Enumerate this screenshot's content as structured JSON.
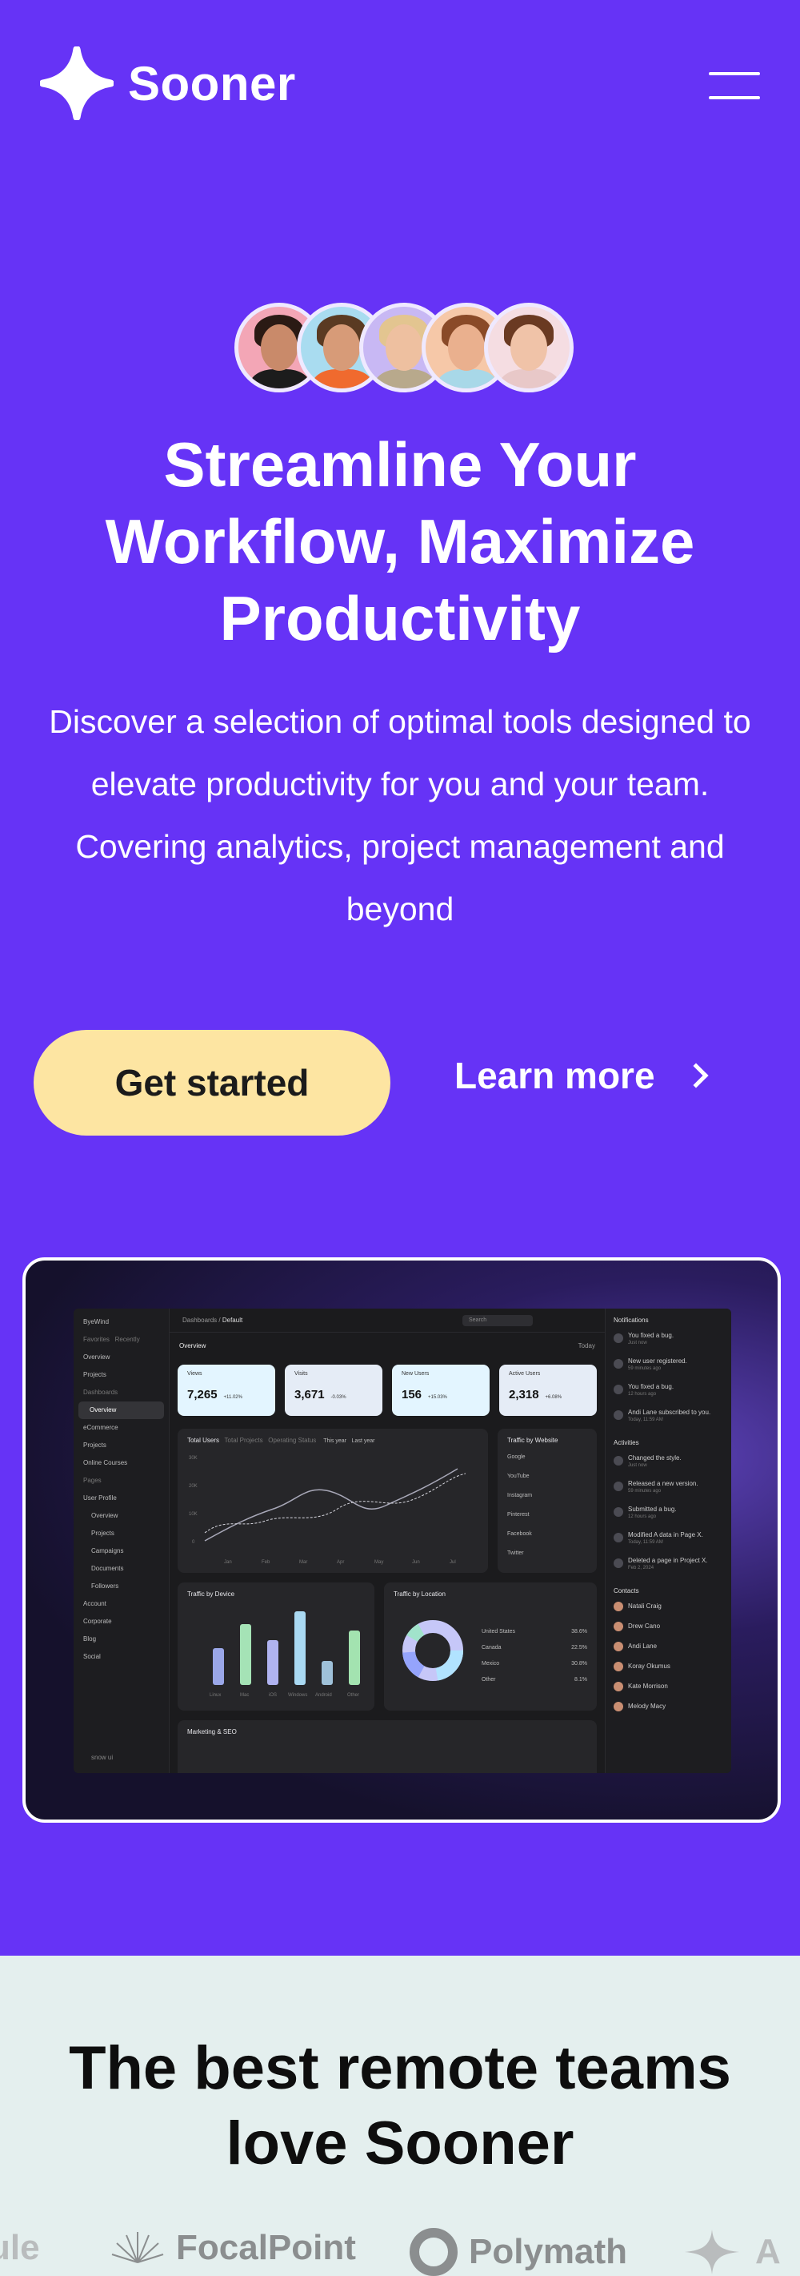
{
  "brand": {
    "name": "Sooner"
  },
  "hero": {
    "headline": "Streamline Your Workflow, Maximize Productivity",
    "subtitle": "Discover a selection of optimal tools designed to elevate productivity for you and your team. Covering analytics, project management and beyond",
    "primary_cta": "Get started",
    "secondary_cta": "Learn more"
  },
  "colors": {
    "hero_bg": "#6633f6",
    "cta_bg": "#fde5a2",
    "section_bg": "#e4efee"
  },
  "dashboard": {
    "user": "ByeWind",
    "sidebar_tabs": [
      "Favorites",
      "Recently"
    ],
    "sidebar_favorites": [
      "Overview",
      "Projects"
    ],
    "sidebar_section_dashboards": "Dashboards",
    "sidebar_dashboards": [
      "Overview",
      "eCommerce",
      "Projects",
      "Online Courses"
    ],
    "sidebar_section_pages": "Pages",
    "sidebar_pages": [
      "User Profile",
      "Overview",
      "Projects",
      "Campaigns",
      "Documents",
      "Followers",
      "Account",
      "Corporate",
      "Blog",
      "Social"
    ],
    "sidebar_footer": "snow ui",
    "breadcrumb": [
      "Dashboards",
      "/",
      "Default"
    ],
    "search_placeholder": "Search",
    "overview_title": "Overview",
    "range": "Today",
    "cards": [
      {
        "label": "Views",
        "value": "7,265",
        "change": "+11.02%",
        "color": "#e3f5ff"
      },
      {
        "label": "Visits",
        "value": "3,671",
        "change": "-0.03%",
        "color": "#e5ecf6"
      },
      {
        "label": "New Users",
        "value": "156",
        "change": "+15.03%",
        "color": "#e3f5ff"
      },
      {
        "label": "Active Users",
        "value": "2,318",
        "change": "+6.08%",
        "color": "#e5ecf6"
      }
    ],
    "users_chart": {
      "tabs": [
        "Total Users",
        "Total Projects",
        "Operating Status"
      ],
      "legend": [
        "This year",
        "Last year"
      ],
      "y_ticks": [
        "30K",
        "20K",
        "10K",
        "0"
      ],
      "months": [
        "Jan",
        "Feb",
        "Mar",
        "Apr",
        "May",
        "Jun",
        "Jul"
      ]
    },
    "traffic_website": {
      "title": "Traffic by Website",
      "sites": [
        "Google",
        "YouTube",
        "Instagram",
        "Pinterest",
        "Facebook",
        "Twitter"
      ]
    },
    "traffic_device": {
      "title": "Traffic by Device",
      "y_ticks": [
        "30K",
        "20K",
        "10K",
        "0"
      ],
      "devices": [
        "Linux",
        "Mac",
        "iOS",
        "Windows",
        "Android",
        "Other"
      ]
    },
    "traffic_location": {
      "title": "Traffic by Location",
      "rows": [
        {
          "name": "United States",
          "value": "38.6%"
        },
        {
          "name": "Canada",
          "value": "22.5%"
        },
        {
          "name": "Mexico",
          "value": "30.8%"
        },
        {
          "name": "Other",
          "value": "8.1%"
        }
      ]
    },
    "marketing_title": "Marketing & SEO",
    "notifications_title": "Notifications",
    "notifications": [
      {
        "text": "You fixed a bug.",
        "time": "Just now"
      },
      {
        "text": "New user registered.",
        "time": "59 minutes ago"
      },
      {
        "text": "You fixed a bug.",
        "time": "12 hours ago"
      },
      {
        "text": "Andi Lane subscribed to you.",
        "time": "Today, 11:59 AM"
      }
    ],
    "activities_title": "Activities",
    "activities": [
      {
        "text": "Changed the style.",
        "time": "Just now"
      },
      {
        "text": "Released a new version.",
        "time": "59 minutes ago"
      },
      {
        "text": "Submitted a bug.",
        "time": "12 hours ago"
      },
      {
        "text": "Modified A data in Page X.",
        "time": "Today, 11:59 AM"
      },
      {
        "text": "Deleted a page in Project X.",
        "time": "Feb 2, 2024"
      }
    ],
    "contacts_title": "Contacts",
    "contacts": [
      "Natali Craig",
      "Drew Cano",
      "Andi Lane",
      "Koray Okumus",
      "Kate Morrison",
      "Melody Macy"
    ]
  },
  "trust": {
    "heading": "The best remote teams love Sooner",
    "logos": [
      "ule",
      "FocalPoint",
      "Polymath",
      "A"
    ]
  }
}
